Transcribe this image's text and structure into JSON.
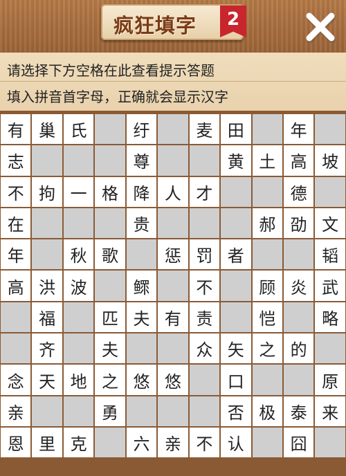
{
  "header": {
    "title": "疯狂填字",
    "badge": "2",
    "close_icon": "close-icon"
  },
  "hints": {
    "line1": "请选择下方空格在此查看提示答题",
    "line2": "填入拼音首字母，正确就会显示汉字"
  },
  "grid": {
    "rows": [
      [
        "有",
        "巢",
        "氏",
        "#",
        "纡",
        "#",
        "麦",
        "田",
        "#",
        "年",
        "#"
      ],
      [
        "志",
        "#",
        "#",
        "#",
        "尊",
        "#",
        "#",
        "黄",
        "土",
        "高",
        "坡"
      ],
      [
        "不",
        "拘",
        "一",
        "格",
        "降",
        "人",
        "才",
        "#",
        "#",
        "德",
        "#"
      ],
      [
        "在",
        "#",
        "#",
        "#",
        "贵",
        "#",
        "#",
        "#",
        "郝",
        "劭",
        "文"
      ],
      [
        "年",
        "#",
        "秋",
        "歌",
        "#",
        "惩",
        "罚",
        "者",
        "#",
        "#",
        "韬"
      ],
      [
        "高",
        "洪",
        "波",
        "#",
        "鳏",
        "#",
        "不",
        "#",
        "顾",
        "炎",
        "武"
      ],
      [
        "#",
        "福",
        "#",
        "匹",
        "夫",
        "有",
        "责",
        "#",
        "恺",
        "#",
        "略"
      ],
      [
        "#",
        "齐",
        "#",
        "夫",
        "#",
        "#",
        "众",
        "矢",
        "之",
        "的",
        "#"
      ],
      [
        "念",
        "天",
        "地",
        "之",
        "悠",
        "悠",
        "#",
        "口",
        "#",
        "#",
        "原"
      ],
      [
        "亲",
        "#",
        "#",
        "勇",
        "#",
        "#",
        "#",
        "否",
        "极",
        "泰",
        "来"
      ],
      [
        "恩",
        "里",
        "克",
        "#",
        "六",
        "亲",
        "不",
        "认",
        "#",
        "囧",
        "#"
      ]
    ]
  }
}
